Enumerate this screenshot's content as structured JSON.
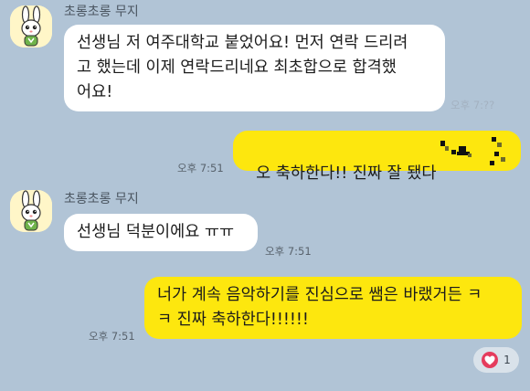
{
  "messages": [
    {
      "sender": "초롱초롱 무지",
      "text": "선생님 저 여주대학교 붙었어요! 먼저 연락 드리려\n고 했는데 이제 연락드리네요 최초합으로 합격했\n어요!",
      "time": "오후 7:??"
    },
    {
      "text": "오 축하한다!! 진짜 잘 됐다",
      "time": "오후 7:51"
    },
    {
      "sender": "초롱초롱 무지",
      "text": "선생님 덕분이에요 ㅠㅠ",
      "time": "오후 7:51"
    },
    {
      "text": "너가 계속 음악하기를 진심으로 쌤은 바랬거든 ㅋ\nㅋ 진짜 축하한다!!!!!!",
      "time": "오후 7:51"
    }
  ],
  "reaction": {
    "icon": "heart-icon",
    "count": "1",
    "color": "#e53c5d"
  },
  "colors": {
    "background": "#b1c4d6",
    "incoming": "#ffffff",
    "outgoing": "#fde70e"
  }
}
